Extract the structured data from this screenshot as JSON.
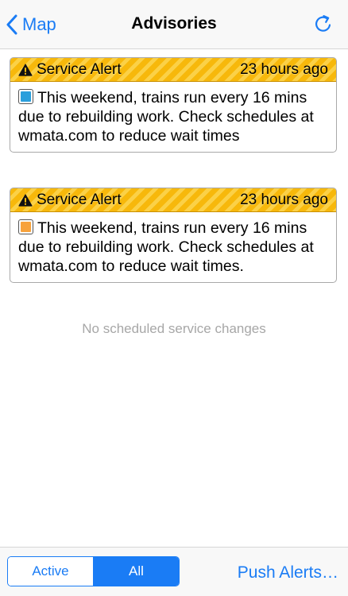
{
  "colors": {
    "accent": "#1a7cf5",
    "alert_header": "#f7b80b",
    "muted_text": "#a7a7a7"
  },
  "navbar": {
    "back_label": "Map",
    "back_icon": "chevron-left-icon",
    "title": "Advisories",
    "refresh_icon": "refresh-icon"
  },
  "alerts": [
    {
      "type": "Service Alert",
      "time": "23 hours ago",
      "icon": "warning-icon",
      "line_color": "#2a9fdc",
      "message": "This weekend, trains run every 16 mins due to rebuilding work. Check schedules at wmata.com to reduce wait times"
    },
    {
      "type": "Service Alert",
      "time": "23 hours ago",
      "icon": "warning-icon",
      "line_color": "#f7a23c",
      "message": "This weekend, trains run every 16 mins due to rebuilding work. Check schedules at wmata.com to reduce wait times."
    }
  ],
  "empty_message": "No scheduled service changes",
  "toolbar": {
    "segments": [
      {
        "label": "Active",
        "selected": false
      },
      {
        "label": "All",
        "selected": true
      }
    ],
    "push_alerts_label": "Push Alerts…"
  }
}
